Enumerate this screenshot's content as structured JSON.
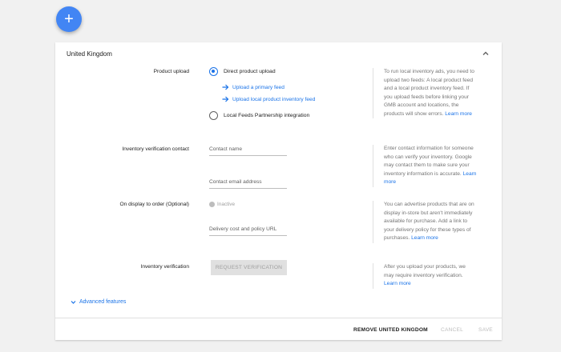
{
  "fab": {
    "icon": "plus-icon",
    "label": "+"
  },
  "card": {
    "title": "United Kingdom",
    "sections": {
      "product_upload": {
        "label": "Product upload",
        "options": [
          {
            "label": "Direct product upload",
            "selected": true
          },
          {
            "label": "Local Feeds Partnership integration",
            "selected": false
          }
        ],
        "links": [
          "Upload a primary feed",
          "Upload local product inventory feed"
        ],
        "help": "To run local inventory ads, you need to upload two feeds: A local product feed and a local product inventory feed. If you upload feeds before linking your GMB account and locations, the products will show errors.",
        "help_link": "Learn more"
      },
      "inventory_contact": {
        "label": "Inventory verification contact",
        "name_placeholder": "Contact name",
        "email_placeholder": "Contact email address",
        "help": "Enter contact information for someone who can verify your inventory. Google may contact them to make sure your inventory information is accurate.",
        "help_link": "Learn more"
      },
      "display_to_order": {
        "label": "On display to order (Optional)",
        "status": "Inactive",
        "url_placeholder": "Delivery cost and policy URL",
        "help": "You can advertise products that are on display in-store but aren't immediately available for purchase. Add a link to your delivery policy for these types of purchases.",
        "help_link": "Learn more"
      },
      "inventory_verification": {
        "label": "Inventory verification",
        "button": "REQUEST VERIFICATION",
        "help": "After you upload your products, we may require inventory verification.",
        "help_link": "Learn more"
      }
    },
    "advanced": "Advanced features",
    "footer": {
      "remove": "REMOVE UNITED KINGDOM",
      "cancel": "CANCEL",
      "save": "SAVE"
    }
  },
  "colors": {
    "accent": "#1a73e8",
    "fab": "#4285f4",
    "background": "#f1f1f1"
  }
}
